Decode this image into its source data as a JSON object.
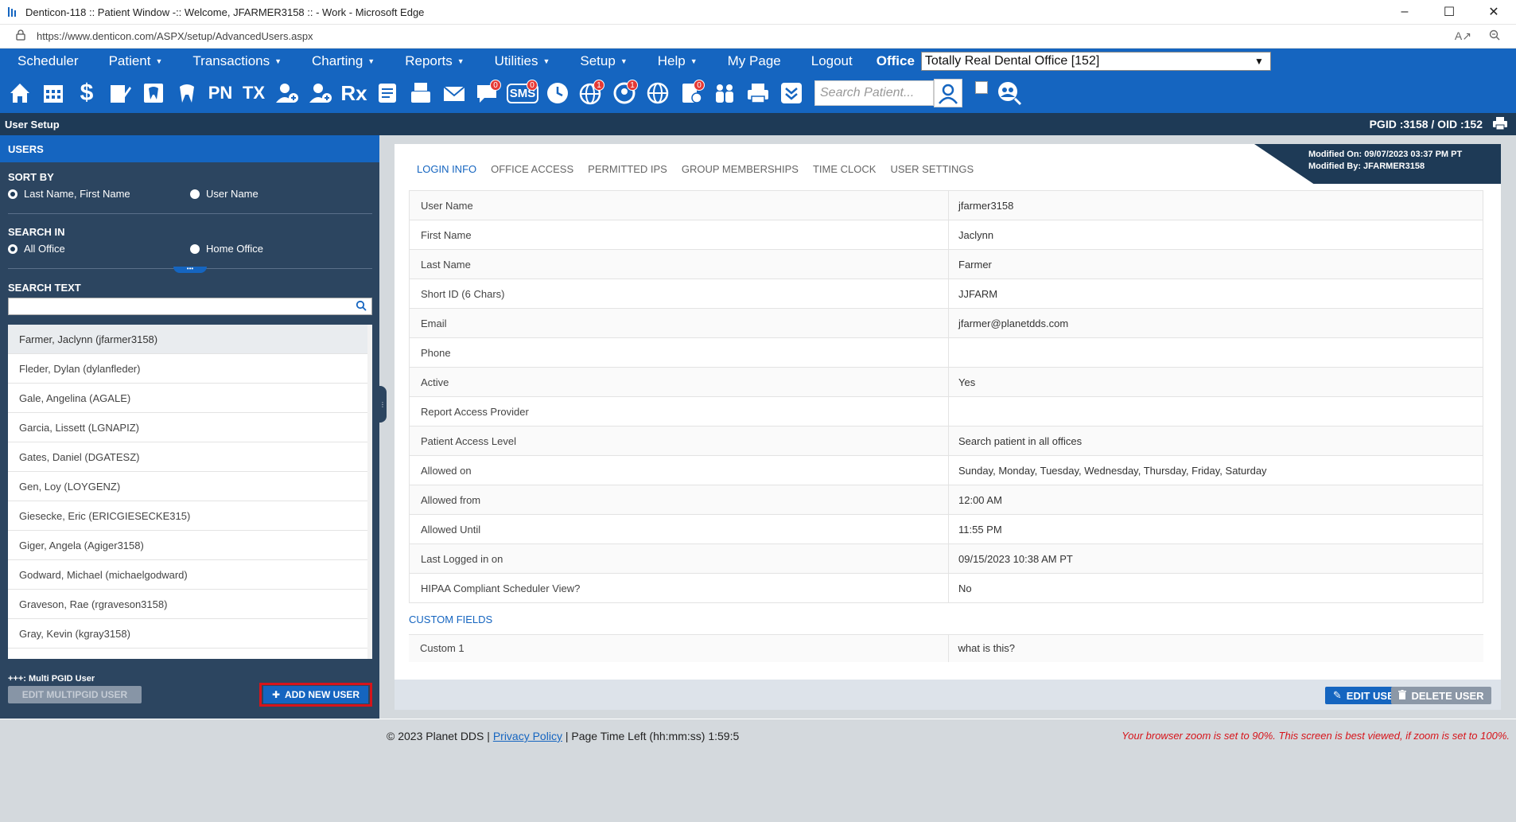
{
  "browser": {
    "window_title": "Denticon-118 :: Patient Window -:: Welcome, JFARMER3158 :: - Work - Microsoft Edge",
    "url": "https://www.denticon.com/ASPX/setup/AdvancedUsers.aspx"
  },
  "menu": {
    "items": [
      "Scheduler",
      "Patient",
      "Transactions",
      "Charting",
      "Reports",
      "Utilities",
      "Setup",
      "Help",
      "My Page",
      "Logout"
    ],
    "office_label": "Office",
    "office_value": "Totally Real Dental Office [152]"
  },
  "toolbar": {
    "search_placeholder": "Search Patient...",
    "badges": {
      "sms": "0",
      "globe": "1",
      "support": "1",
      "form": "0",
      "message": "0"
    },
    "labels": {
      "pn": "PN",
      "tx": "TX",
      "rx": "Rx",
      "sms": "SMS"
    }
  },
  "setup_bar": {
    "title": "User Setup",
    "pgid": "PGID :3158  /  OID :152"
  },
  "left_panel": {
    "header": "USERS",
    "sort_by": {
      "title": "SORT BY",
      "option1": "Last Name, First Name",
      "option2": "User Name"
    },
    "search_in": {
      "title": "SEARCH IN",
      "option1": "All Office",
      "option2": "Home Office"
    },
    "search_text_title": "SEARCH TEXT",
    "users": [
      "Farmer, Jaclynn (jfarmer3158)",
      "Fleder, Dylan (dylanfleder)",
      "Gale, Angelina (AGALE)",
      "Garcia, Lissett (LGNAPIZ)",
      "Gates, Daniel (DGATESZ)",
      "Gen, Loy (LOYGENZ)",
      "Giesecke, Eric (ERICGIESECKE315)",
      "Giger, Angela (Agiger3158)",
      "Godward, Michael (michaelgodward)",
      "Graveson, Rae (rgraveson3158)",
      "Gray, Kevin (kgray3158)"
    ],
    "multi_label": "+++: Multi PGID User",
    "edit_multipgid_label": "EDIT MULTIPGID USER",
    "add_new_user_label": "ADD NEW USER"
  },
  "right_panel": {
    "tabs": [
      "LOGIN INFO",
      "OFFICE ACCESS",
      "PERMITTED IPS",
      "GROUP MEMBERSHIPS",
      "TIME CLOCK",
      "USER SETTINGS"
    ],
    "modified_on": "Modified On: 09/07/2023 03:37 PM PT",
    "modified_by": "Modified By: JFARMER3158",
    "fields": [
      [
        "User Name",
        "jfarmer3158"
      ],
      [
        "First Name",
        "Jaclynn"
      ],
      [
        "Last Name",
        "Farmer"
      ],
      [
        "Short ID (6 Chars)",
        "JJFARM"
      ],
      [
        "Email",
        "jfarmer@planetdds.com"
      ],
      [
        "Phone",
        ""
      ],
      [
        "Active",
        "Yes"
      ],
      [
        "Report Access Provider",
        ""
      ],
      [
        "Patient Access Level",
        "Search patient in all offices"
      ],
      [
        "Allowed on",
        "Sunday, Monday, Tuesday, Wednesday, Thursday, Friday, Saturday"
      ],
      [
        "Allowed from",
        "12:00 AM"
      ],
      [
        "Allowed Until",
        "11:55 PM"
      ],
      [
        "Last Logged in on",
        "09/15/2023 10:38 AM PT"
      ],
      [
        "HIPAA Compliant Scheduler View?",
        "No"
      ]
    ],
    "custom_fields_title": "CUSTOM FIELDS",
    "custom_fields": [
      [
        "Custom 1",
        "what is this?"
      ]
    ],
    "edit_user_label": "EDIT USER",
    "delete_user_label": "DELETE USER"
  },
  "footer": {
    "copyright": "© 2023 Planet DDS |",
    "privacy": "Privacy Policy",
    "time_left": "| Page Time Left (hh:mm:ss) 1:59:5",
    "zoom_warning": "Your browser zoom is set to 90%. This screen is best viewed, if zoom is set to 100%."
  },
  "colors": {
    "brand_blue": "#1565c0",
    "navy": "#1e3a56",
    "panel": "#2c4560",
    "highlight_red": "#d7141a"
  }
}
